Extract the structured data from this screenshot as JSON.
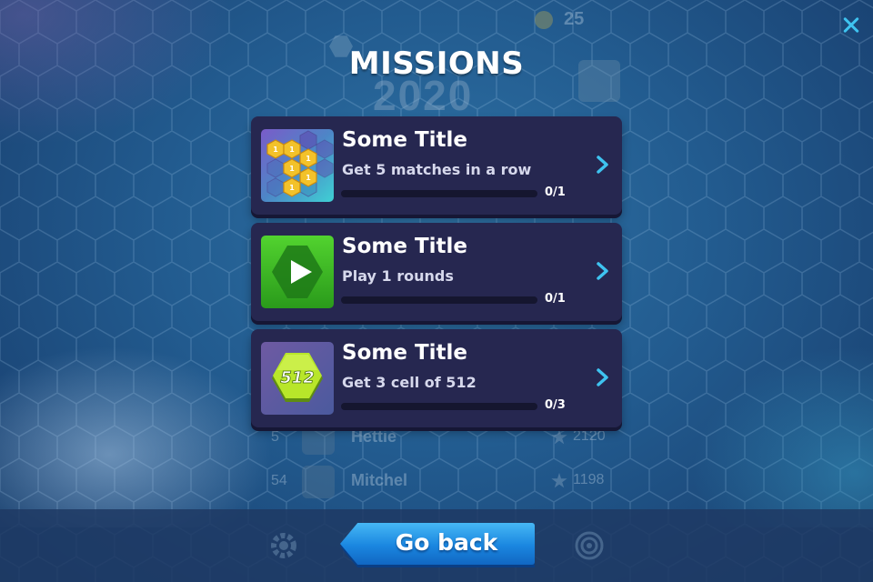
{
  "screen": {
    "title": "MISSIONS",
    "close_icon": "close-icon"
  },
  "underlay": {
    "coins": "25",
    "year": "2020",
    "rows": [
      {
        "rank": "5",
        "name": "Hettie",
        "score": "2120"
      },
      {
        "rank": "54",
        "name": "Mitchel",
        "score": "1198"
      }
    ]
  },
  "missions": [
    {
      "icon": "honeycomb-coins-icon",
      "title": "Some Title",
      "description": "Get 5 matches in a row",
      "progress_text": "0/1",
      "progress": 0
    },
    {
      "icon": "play-hexagon-icon",
      "title": "Some Title",
      "description": "Play 1 rounds",
      "progress_text": "0/1",
      "progress": 0
    },
    {
      "icon": "hexagon-512-icon",
      "icon_label": "512",
      "title": "Some Title",
      "description": "Get 3 cell of 512",
      "progress_text": "0/3",
      "progress": 0
    }
  ],
  "footer": {
    "go_back_label": "Go back"
  },
  "colors": {
    "accent": "#3ec3f0",
    "card": "#262750",
    "button": "#1a86e0"
  }
}
